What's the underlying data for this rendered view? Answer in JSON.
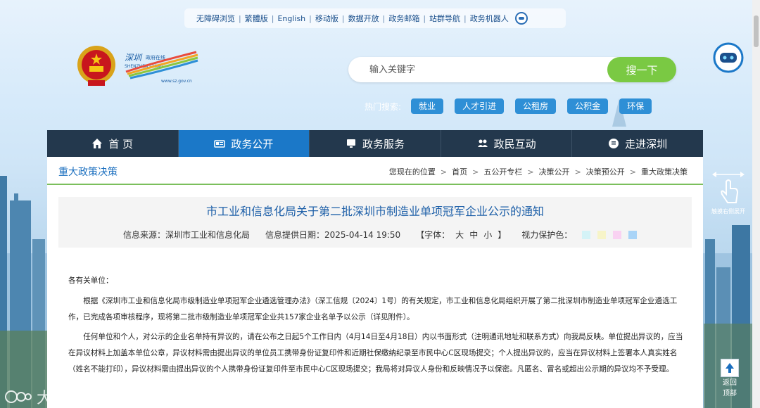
{
  "topbar": {
    "links": [
      "无障碍浏览",
      "繁體版",
      "English",
      "移动版",
      "数据开放",
      "政务邮箱",
      "站群导航",
      "政务机器人"
    ]
  },
  "logo": {
    "site_text": "www.sz.gov.cn"
  },
  "search": {
    "placeholder": "输入关键字",
    "button": "搜一下"
  },
  "hot": {
    "label": "热门搜索:",
    "tags": [
      "就业",
      "人才引进",
      "公租房",
      "公积金",
      "环保"
    ]
  },
  "nav": {
    "items": [
      {
        "label": "首 页",
        "icon": "home-icon"
      },
      {
        "label": "政务公开",
        "icon": "news-icon"
      },
      {
        "label": "政务服务",
        "icon": "monitor-icon"
      },
      {
        "label": "政民互动",
        "icon": "people-icon"
      },
      {
        "label": "走进深圳",
        "icon": "info-icon"
      }
    ],
    "active_index": 1
  },
  "section": {
    "title": "重大政策决策"
  },
  "breadcrumb": {
    "prefix": "您现在的位置",
    "items": [
      "首页",
      "五公开专栏",
      "决策公开",
      "决策预公开",
      "重大政策决策"
    ]
  },
  "article": {
    "title": "市工业和信息化局关于第二批深圳市制造业单项冠军企业公示的通知",
    "source": "信息来源：深圳市工业和信息化局",
    "date": "信息提供日期：2025-04-14 19:50",
    "font_label": "【字体：",
    "font_sizes": [
      "大",
      "中",
      "小"
    ],
    "font_end": "】",
    "eye_label": "视力保护色：",
    "eye_colors": [
      "#d4f3f7",
      "#f7f4c8",
      "#f9d2f2",
      "#a9d4f7"
    ],
    "greeting": "各有关单位：",
    "paragraphs": [
      "根据《深圳市工业和信息化局市级制造业单项冠军企业遴选管理办法》（深工信规〔2024〕1号）的有关规定，市工业和信息化局组织开展了第二批深圳市制造业单项冠军企业遴选工作，已完成各项审核程序，现将第二批市级制造业单项冠军企业共157家企业名单予以公示（详见附件）。",
      "任何单位和个人，对公示的企业名单持有异议的，请在公布之日起5个工作日内（4月14日至4月18日）内以书面形式（注明通讯地址和联系方式）向我局反映。单位提出异议的，应当在异议材料上加盖本单位公章，异议材料需由提出异议的单位员工携带身份证复印件和近期社保缴纳纪录至市民中心C区现场提交；个人提出异议的，应当在异议材料上签署本人真实姓名（姓名不能打印），异议材料需由提出异议的个人携带身份证复印件至市民中心C区现场提交；我局将对异议人身份和反映情况予以保密。凡匿名、冒名或超出公示期的异议均不予受理。"
    ]
  },
  "side": {
    "hint": "触摸右侧展开",
    "backtop_1": "返回",
    "backtop_2": "顶部"
  },
  "watermark": "大数跨境"
}
